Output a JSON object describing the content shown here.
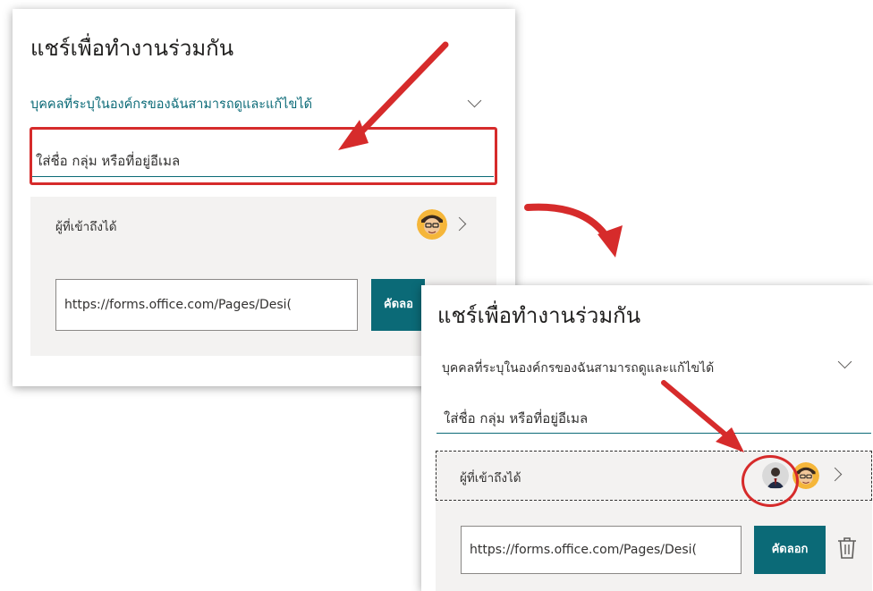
{
  "share_panel": {
    "title": "แชร์เพื่อทำงานร่วมกัน",
    "permission_label": "บุคคลที่ระบุในองค์กรของฉันสามารถดูและแก้ไขได้",
    "people_placeholder": "ใส่ชื่อ กลุ่ม หรือที่อยู่อีเมล",
    "access_label": "ผู้ที่เข้าถึงได้",
    "link_value": "https://forms.office.com/Pages/Desi(",
    "copy_label_partial": "คัดลอ",
    "copy_label": "คัดลอก"
  },
  "icons": {
    "chevron_down": "chevron-down-icon",
    "chevron_right": "chevron-right-icon",
    "delete": "trash-icon",
    "avatar_owner": "cartoon-avatar",
    "avatar_added": "person-avatar"
  },
  "colors": {
    "accent": "#0b6a77",
    "annotation": "#d62b2b",
    "row_background": "#f3f2f1"
  }
}
